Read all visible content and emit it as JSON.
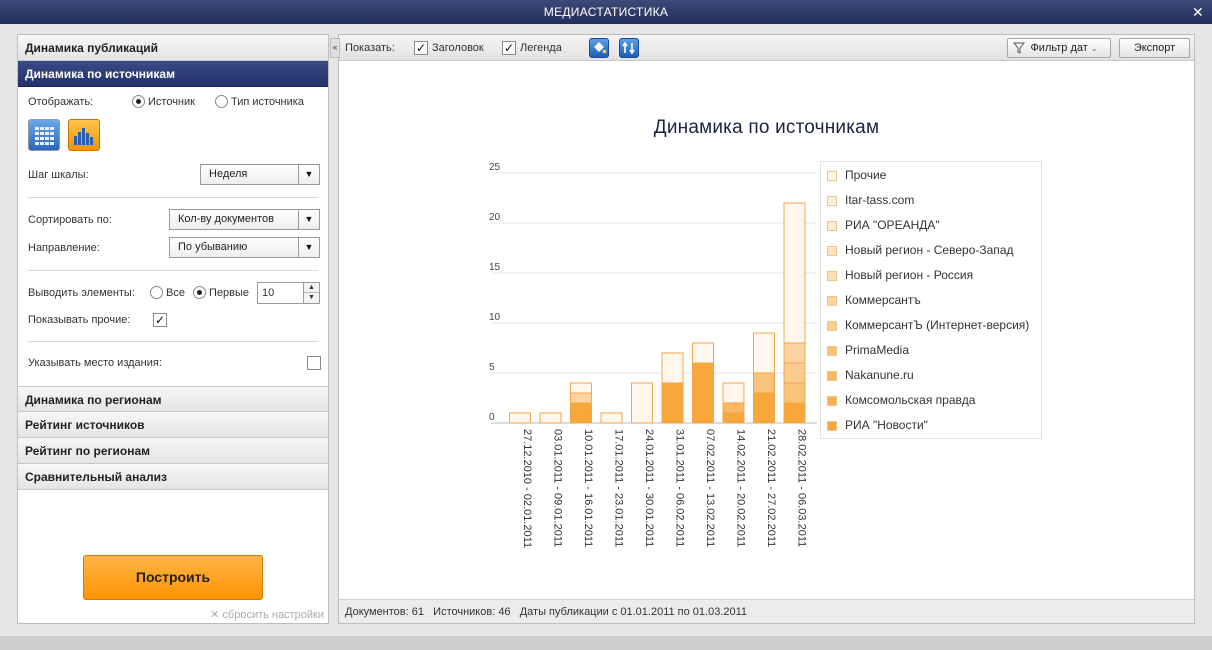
{
  "window": {
    "title": "МЕДИАСТАТИСТИКА",
    "close_glyph": "✕"
  },
  "sidebar": {
    "sections": [
      {
        "label": "Динамика публикаций",
        "active": false
      },
      {
        "label": "Динамика по источникам",
        "active": true
      },
      {
        "label": "Динамика по регионам",
        "active": false
      },
      {
        "label": "Рейтинг источников",
        "active": false
      },
      {
        "label": "Рейтинг по регионам",
        "active": false
      },
      {
        "label": "Сравнительный анализ",
        "active": false
      }
    ],
    "display_label": "Отображать:",
    "display_options": [
      "Источник",
      "Тип источника"
    ],
    "display_selected": "Источник",
    "view_buttons": [
      "table-view-icon",
      "chart-view-icon"
    ],
    "scale_step_label": "Шаг шкалы:",
    "scale_step_value": "Неделя",
    "sort_by_label": "Сортировать по:",
    "sort_by_value": "Кол-ву документов",
    "direction_label": "Направление:",
    "direction_value": "По убыванию",
    "show_elements_label": "Выводить элементы:",
    "show_all_label": "Все",
    "show_first_label": "Первые",
    "show_first_value": "10",
    "show_others_label": "Показывать прочие:",
    "show_others_checked": "✓",
    "publication_place_label": "Указывать место издания:",
    "build_button": "Построить",
    "reset_label": "сбросить настройки"
  },
  "toolbar": {
    "show_label": "Показать:",
    "header_label": "Заголовок",
    "legend_label": "Легенда",
    "check_mark": "✓",
    "filter_dates": "Фильтр дат",
    "export": "Экспорт"
  },
  "status": {
    "documents": "Документов: 61",
    "sources": "Источников: 46",
    "dates": "Даты публикации с 01.01.2011 по 01.03.2011"
  },
  "colors": {
    "title_bar": "#2f3c6e",
    "accent_orange": "#ff9a00",
    "active_section": "#2b3975"
  },
  "chart_data": {
    "type": "bar",
    "stacked": true,
    "title": "Динамика по источникам",
    "categories": [
      "27.12.2010 - 02.01.2011",
      "03.01.2011 - 09.01.2011",
      "10.01.2011 - 16.01.2011",
      "17.01.2011 - 23.01.2011",
      "24.01.2011 - 30.01.2011",
      "31.01.2011 - 06.02.2011",
      "07.02.2011 - 13.02.2011",
      "14.02.2011 - 20.02.2011",
      "21.02.2011 - 27.02.2011",
      "28.02.2011 - 06.03.2011"
    ],
    "series": [
      {
        "name": "РИА \"Новости\"",
        "color": "#f8a73a",
        "values": [
          0,
          0,
          2,
          0,
          0,
          4,
          6,
          1,
          3,
          2
        ]
      },
      {
        "name": "Комсомольская правда",
        "color": "#f9b04f",
        "values": [
          0,
          0,
          0,
          0,
          0,
          0,
          0,
          0,
          0,
          0
        ]
      },
      {
        "name": "Nakanune.ru",
        "color": "#fab865",
        "values": [
          0,
          0,
          0,
          0,
          0,
          0,
          0,
          1,
          0,
          0
        ]
      },
      {
        "name": "PrimaMedia",
        "color": "#fbc27a",
        "values": [
          0,
          0,
          0,
          0,
          0,
          0,
          0,
          0,
          2,
          2
        ]
      },
      {
        "name": "КоммерсантЪ (Интернет-версия)",
        "color": "#fbcb8f",
        "values": [
          0,
          0,
          0,
          0,
          0,
          0,
          0,
          0,
          0,
          2
        ]
      },
      {
        "name": "Коммерсантъ",
        "color": "#fcd49f",
        "values": [
          0,
          0,
          1,
          0,
          0,
          0,
          0,
          0,
          0,
          2
        ]
      },
      {
        "name": "Новый регион - Россия",
        "color": "#fcdcb1",
        "values": [
          0,
          0,
          0,
          0,
          0,
          0,
          0,
          0,
          0,
          0
        ]
      },
      {
        "name": "Новый регион - Северо-Запад",
        "color": "#fde4c2",
        "values": [
          0,
          0,
          0,
          0,
          0,
          0,
          0,
          0,
          0,
          0
        ]
      },
      {
        "name": "РИА \"ОРЕАНДА\"",
        "color": "#fdebd2",
        "values": [
          0,
          0,
          0,
          0,
          0,
          0,
          0,
          0,
          0,
          0
        ]
      },
      {
        "name": "Itar-tass.com",
        "color": "#fef0de",
        "values": [
          0,
          0,
          0,
          0,
          0,
          0,
          0,
          0,
          0,
          0
        ]
      },
      {
        "name": "Прочие",
        "color": "#fff6ec",
        "values": [
          1,
          1,
          1,
          1,
          4,
          3,
          2,
          2,
          4,
          14
        ]
      }
    ],
    "totals": [
      1,
      1,
      4,
      1,
      4,
      7,
      8,
      4,
      9,
      22
    ],
    "y_ticks": [
      0,
      5,
      10,
      15,
      20,
      25
    ],
    "ylim": [
      0,
      25
    ],
    "grid": true,
    "legend_position": "right"
  }
}
